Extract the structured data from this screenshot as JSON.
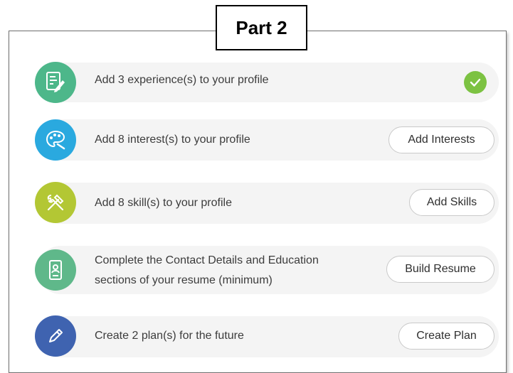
{
  "label": "Part 2",
  "colors": {
    "experience_icon": "#4db78a",
    "interest_icon": "#2aa9df",
    "skill_icon": "#b3c734",
    "resume_icon": "#5fb88a",
    "plan_icon": "#3f63b0",
    "check": "#7cc242"
  },
  "tasks": [
    {
      "icon": "document-edit-icon",
      "text": "Add 3 experience(s) to your profile",
      "status": "complete"
    },
    {
      "icon": "palette-icon",
      "text": "Add 8 interest(s) to your profile",
      "button": "Add Interests"
    },
    {
      "icon": "tools-icon",
      "text": "Add 8 skill(s) to your profile",
      "button": "Add Skills"
    },
    {
      "icon": "resume-icon",
      "text_line1": "Complete the Contact Details and Education",
      "text_line2": "sections of your resume (minimum)",
      "button": "Build Resume"
    },
    {
      "icon": "pencil-icon",
      "text": "Create 2 plan(s) for the future",
      "button": "Create Plan"
    }
  ]
}
